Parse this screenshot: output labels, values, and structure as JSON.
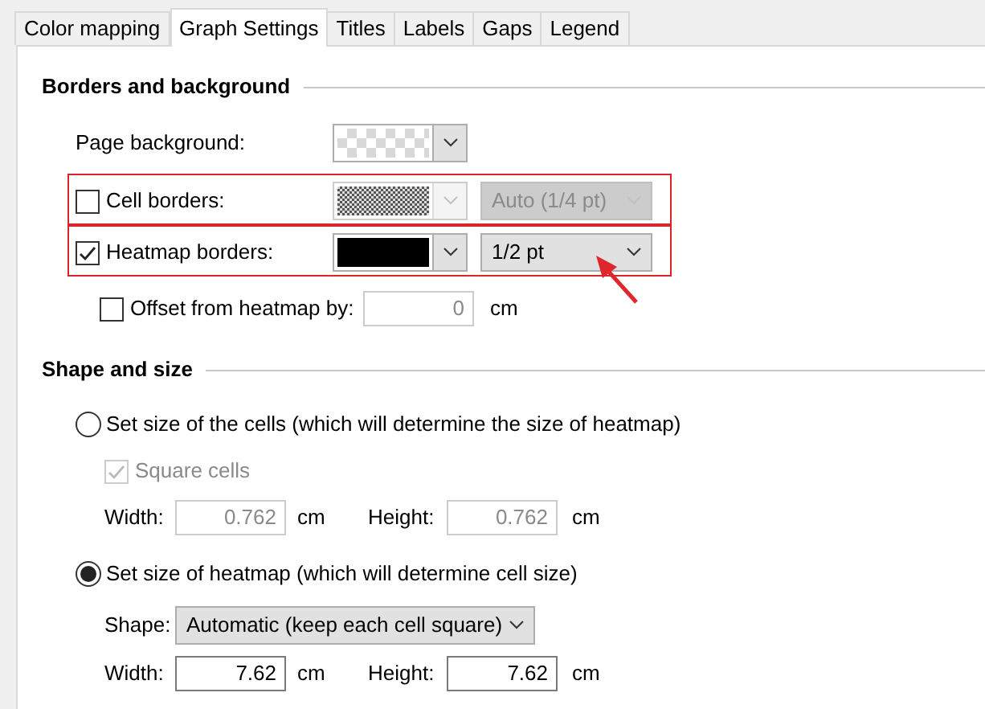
{
  "tabs": [
    {
      "label": "Color mapping",
      "selected": false
    },
    {
      "label": "Graph Settings",
      "selected": true
    },
    {
      "label": "Titles",
      "selected": false
    },
    {
      "label": "Labels",
      "selected": false
    },
    {
      "label": "Gaps",
      "selected": false
    },
    {
      "label": "Legend",
      "selected": false
    }
  ],
  "borders_section": {
    "title": "Borders and background",
    "page_background": {
      "label": "Page background:",
      "swatch": {
        "kind": "checker"
      }
    },
    "cell_borders": {
      "label": "Cell borders:",
      "checked": false,
      "swatch": {
        "kind": "dots"
      },
      "width": "Auto (1/4 pt)",
      "disabled": true,
      "highlighted": true
    },
    "heatmap_borders": {
      "label": "Heatmap borders:",
      "checked": true,
      "swatch": {
        "kind": "solid",
        "color": "#000000"
      },
      "width": "1/2 pt",
      "disabled": false,
      "highlighted": true
    },
    "offset": {
      "label": "Offset from heatmap by:",
      "checked": false,
      "value": "0",
      "unit": "cm"
    }
  },
  "shape_section": {
    "title": "Shape and size",
    "options": [
      {
        "label": "Set size of the cells (which will determine the size of heatmap)",
        "selected": false,
        "square_cells": {
          "label": "Square cells",
          "checked": true
        },
        "width": {
          "label": "Width:",
          "value": "0.762",
          "unit": "cm"
        },
        "height": {
          "label": "Height:",
          "value": "0.762",
          "unit": "cm"
        }
      },
      {
        "label": "Set size of heatmap (which will determine cell size)",
        "selected": true,
        "shape": {
          "label": "Shape:",
          "value": "Automatic (keep each cell square)"
        },
        "width": {
          "label": "Width:",
          "value": "7.62",
          "unit": "cm"
        },
        "height": {
          "label": "Height:",
          "value": "7.62",
          "unit": "cm"
        }
      }
    ]
  },
  "annotation_arrow": true
}
